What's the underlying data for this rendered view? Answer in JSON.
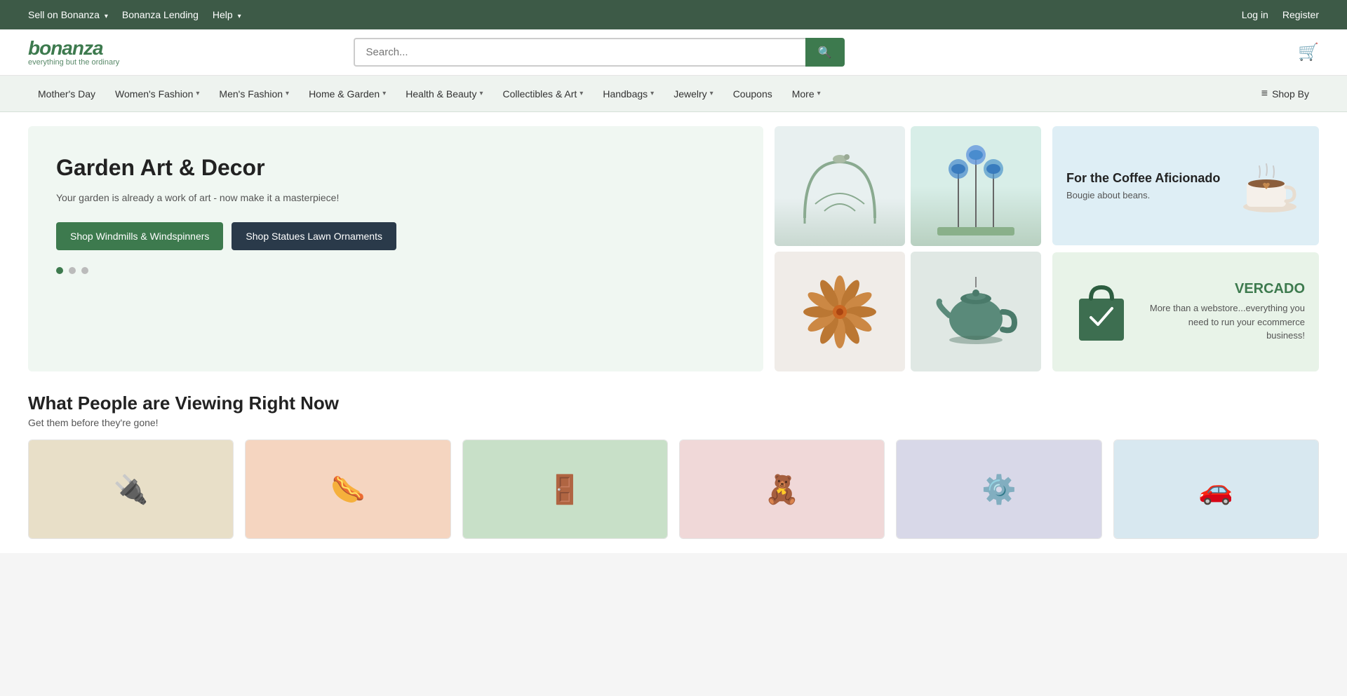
{
  "topbar": {
    "left_items": [
      {
        "label": "Sell on Bonanza",
        "has_arrow": true
      },
      {
        "label": "Bonanza Lending",
        "has_arrow": false
      },
      {
        "label": "Help",
        "has_arrow": true
      }
    ],
    "right_items": [
      {
        "label": "Log in"
      },
      {
        "label": "Register"
      }
    ]
  },
  "header": {
    "logo_text": "bonanza",
    "logo_tagline": "everything but the ordinary",
    "search_placeholder": "Search...",
    "search_button_icon": "🔍",
    "cart_icon": "🛒"
  },
  "cat_nav": {
    "items": [
      {
        "label": "Mother's Day",
        "has_arrow": false
      },
      {
        "label": "Women's Fashion",
        "has_arrow": true
      },
      {
        "label": "Men's Fashion",
        "has_arrow": true
      },
      {
        "label": "Home & Garden",
        "has_arrow": true
      },
      {
        "label": "Health & Beauty",
        "has_arrow": true
      },
      {
        "label": "Collectibles & Art",
        "has_arrow": true
      },
      {
        "label": "Handbags",
        "has_arrow": true
      },
      {
        "label": "Jewelry",
        "has_arrow": true
      },
      {
        "label": "Coupons",
        "has_arrow": false
      },
      {
        "label": "More",
        "has_arrow": true
      }
    ],
    "shopby_label": "Shop By",
    "shopby_icon": "≡"
  },
  "hero": {
    "title": "Garden Art & Decor",
    "description": "Your garden is already a work of art - now make it a masterpiece!",
    "btn1_label": "Shop Windmills & Windspinners",
    "btn2_label": "Shop Statues Lawn Ornaments",
    "dots": [
      {
        "active": true
      },
      {
        "active": false
      },
      {
        "active": false
      }
    ]
  },
  "promo_coffee": {
    "title": "For the Coffee Aficionado",
    "subtitle": "Bougie about beans."
  },
  "promo_vercado": {
    "brand": "VERCADO",
    "description": "More than a webstore...everything you need to run your ecommerce business!"
  },
  "trending": {
    "title": "What People are Viewing Right Now",
    "subtitle": "Get them before they're gone!",
    "products": [
      {
        "bg": "prod-bg-1",
        "icon": "🔌"
      },
      {
        "bg": "prod-bg-2",
        "icon": "🌭"
      },
      {
        "bg": "prod-bg-3",
        "icon": "🚪"
      },
      {
        "bg": "prod-bg-4",
        "icon": "🧸"
      },
      {
        "bg": "prod-bg-5",
        "icon": "⚙️"
      },
      {
        "bg": "prod-bg-6",
        "icon": "🚗"
      }
    ]
  }
}
